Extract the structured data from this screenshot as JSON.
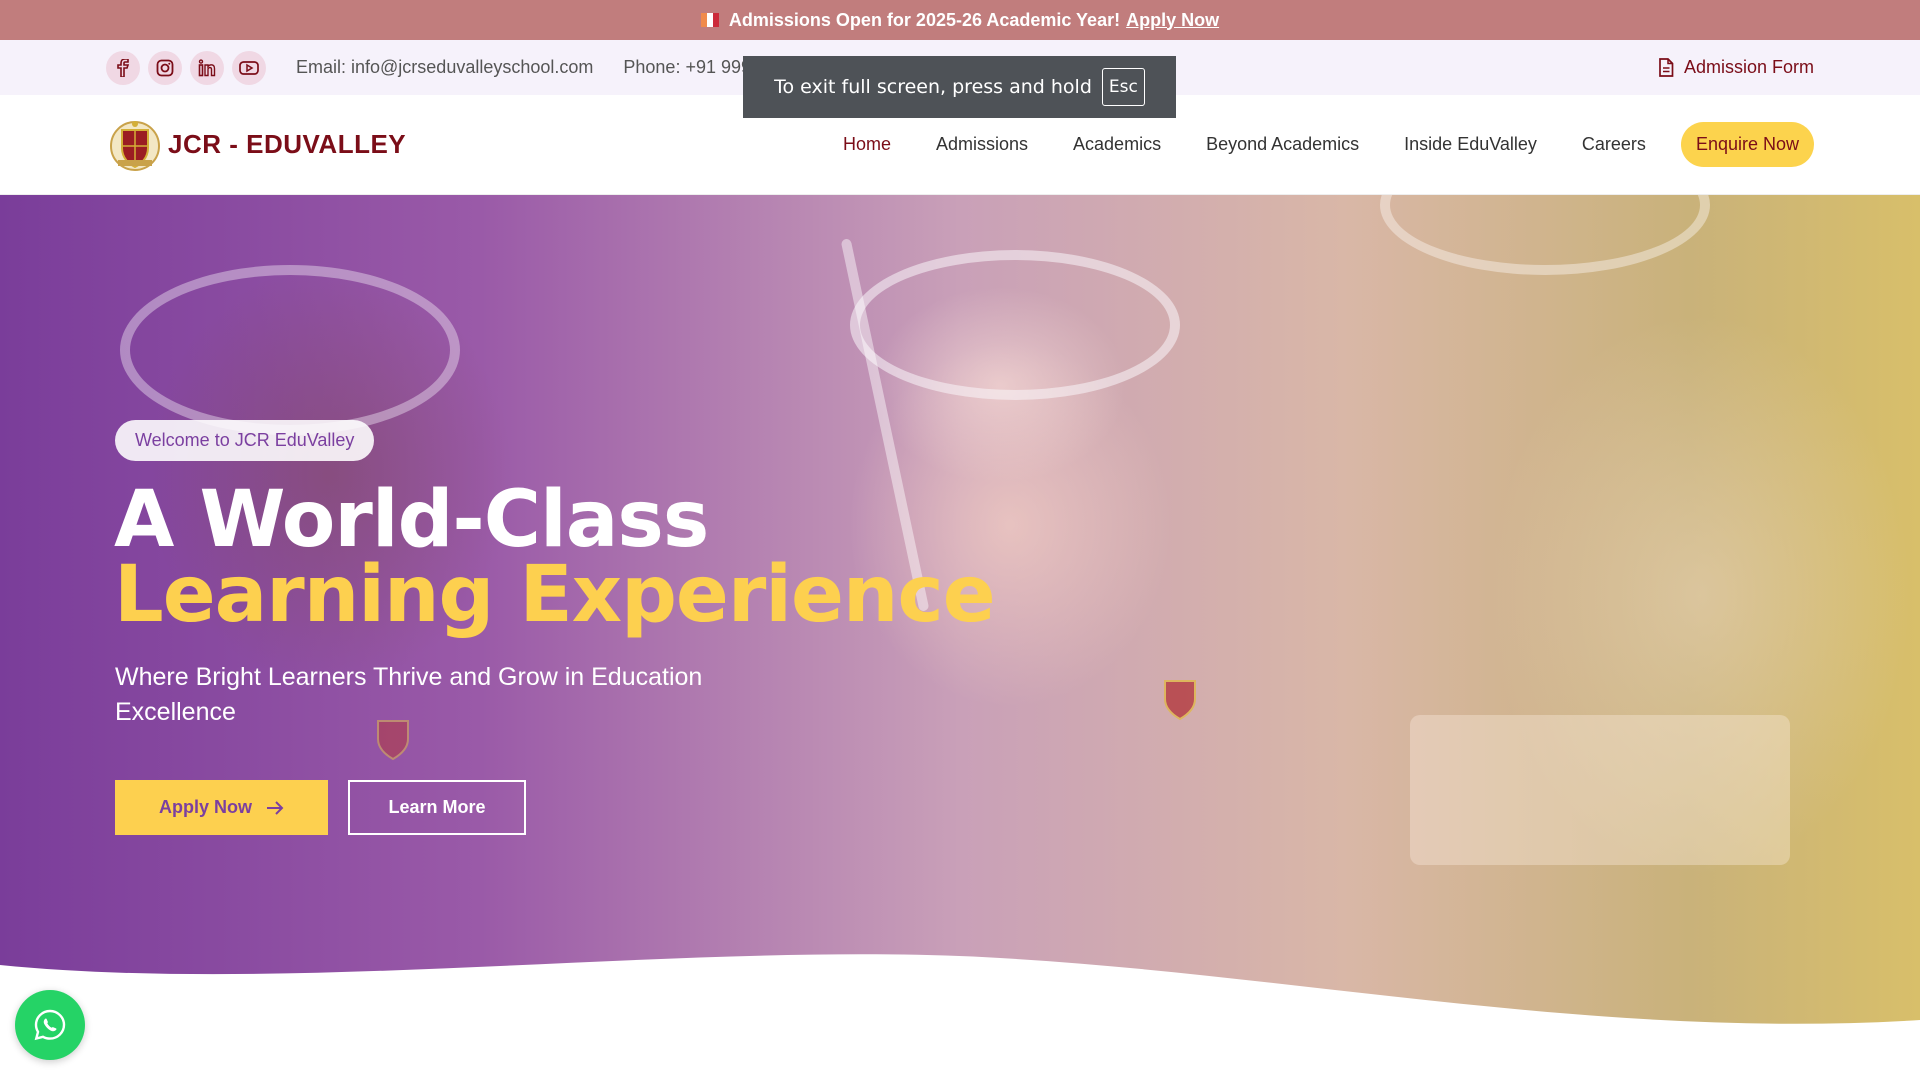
{
  "announcement": {
    "text": "Admissions Open for 2025-26 Academic Year!",
    "link": "Apply Now"
  },
  "topbar": {
    "social_icons": [
      "facebook-icon",
      "instagram-icon",
      "linkedin-icon",
      "youtube-icon"
    ],
    "email": "Email: info@jcrseduvalleyschool.com",
    "phone": "Phone: +91 999799 3118 / +91 999799 3119",
    "admission_form": "Admission Form"
  },
  "fullscreen_toast": {
    "text": "To exit full screen, press and hold",
    "key": "Esc"
  },
  "navbar": {
    "brand": "JCR - EDUVALLEY",
    "menu": [
      "Home",
      "Admissions",
      "Academics",
      "Beyond Academics",
      "Inside EduValley",
      "Careers"
    ],
    "enquire": "Enquire Now"
  },
  "hero": {
    "badge": "Welcome to JCR EduValley",
    "title_line1": "A World-Class",
    "title_line2": "Learning Experience",
    "subtitle": "Where Bright Learners Thrive and Grow in Education Excellence",
    "apply_button": "Apply Now",
    "learn_button": "Learn More"
  },
  "colors": {
    "brand_maroon": "#7b0d18",
    "accent_yellow": "#fdd04f",
    "announce_bg": "#c17d7d",
    "hero_purple": "#7a3d9a",
    "whatsapp_green": "#25d366"
  }
}
